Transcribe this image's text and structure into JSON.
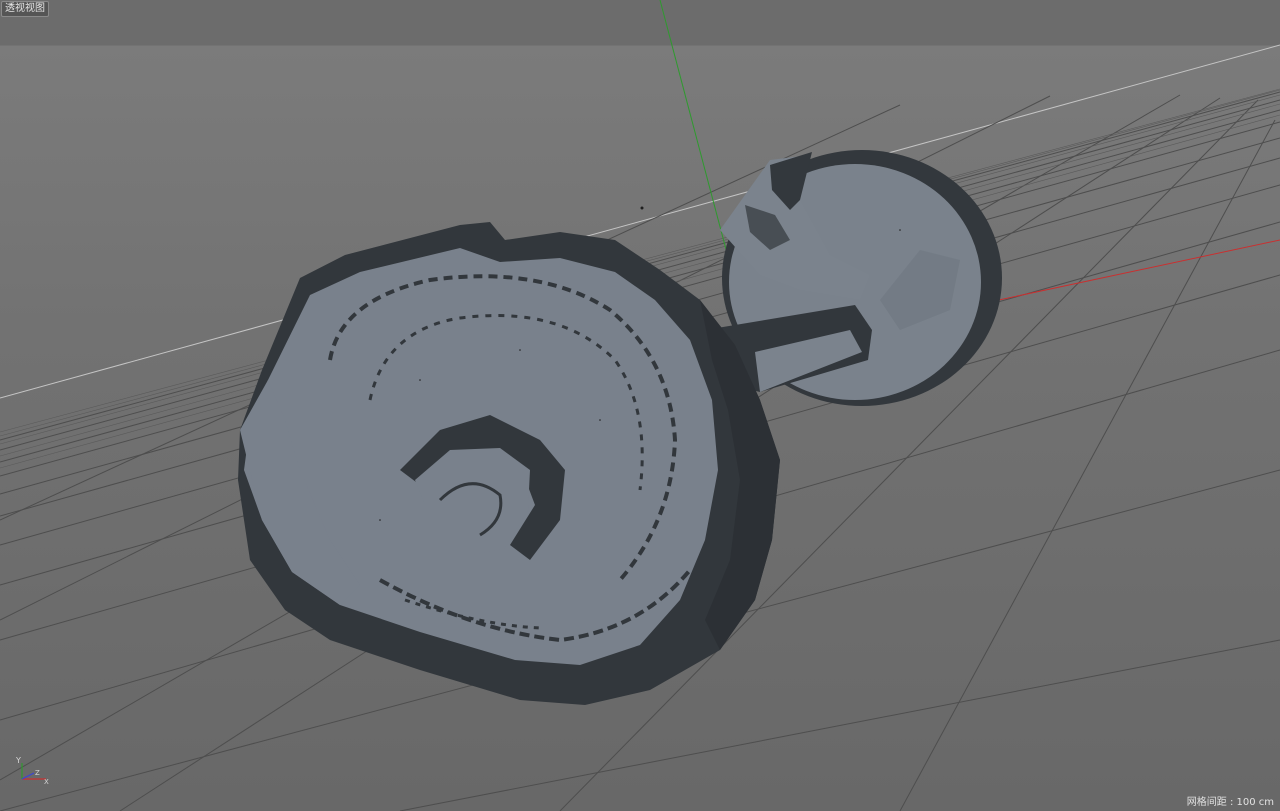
{
  "viewport": {
    "label": "透视视图",
    "grid_spacing_label": "网格间距 : 100 cm",
    "background": "#727272",
    "grid_color": "#4a4a4a",
    "horizon_color": "#bdbdbd",
    "axis_colors": {
      "x": "#c93030",
      "y": "#2e9a2e",
      "z": "#3a44d8"
    },
    "model_colors": {
      "light": "#79818c",
      "dark": "#32373c"
    }
  },
  "gizmo": {
    "y_label": "Y",
    "z_label": "Z",
    "x_label": "X"
  }
}
